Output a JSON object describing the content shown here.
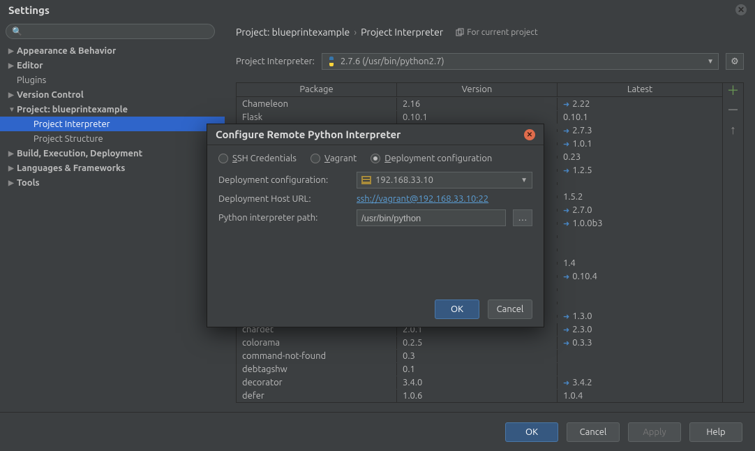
{
  "title": "Settings",
  "search_placeholder": "",
  "sidebar": {
    "items": [
      {
        "label": "Appearance & Behavior",
        "arrow": "▶",
        "bold": true
      },
      {
        "label": "Editor",
        "arrow": "▶",
        "bold": true
      },
      {
        "label": "Plugins",
        "arrow": "",
        "bold": false
      },
      {
        "label": "Version Control",
        "arrow": "▶",
        "bold": true
      },
      {
        "label": "Project: blueprintexample",
        "arrow": "▼",
        "bold": true
      },
      {
        "label": "Project Interpreter",
        "arrow": "",
        "bold": false,
        "indent": true,
        "selected": true
      },
      {
        "label": "Project Structure",
        "arrow": "",
        "bold": false,
        "indent": true
      },
      {
        "label": "Build, Execution, Deployment",
        "arrow": "▶",
        "bold": true
      },
      {
        "label": "Languages & Frameworks",
        "arrow": "▶",
        "bold": true
      },
      {
        "label": "Tools",
        "arrow": "▶",
        "bold": true
      }
    ]
  },
  "breadcrumb": {
    "project": "Project: blueprintexample",
    "page": "Project Interpreter",
    "for_project": "For current project"
  },
  "interpreter": {
    "label": "Project Interpreter:",
    "value": "2.7.6 (/usr/bin/python2.7)"
  },
  "table": {
    "headers": [
      "Package",
      "Version",
      "Latest"
    ],
    "rows": [
      {
        "pkg": "Chameleon",
        "ver": "2.16",
        "lat": "2.22",
        "up": true
      },
      {
        "pkg": "Flask",
        "ver": "0.10.1",
        "lat": "0.10.1",
        "up": false
      },
      {
        "pkg": "",
        "ver": "",
        "lat": "2.7.3",
        "up": true
      },
      {
        "pkg": "",
        "ver": "",
        "lat": "1.0.1",
        "up": true
      },
      {
        "pkg": "",
        "ver": "",
        "lat": "0.23",
        "up": false
      },
      {
        "pkg": "",
        "ver": "",
        "lat": "1.2.5",
        "up": true
      },
      {
        "pkg": "",
        "ver": "",
        "lat": "",
        "up": false
      },
      {
        "pkg": "",
        "ver": "",
        "lat": "1.5.2",
        "up": false
      },
      {
        "pkg": "",
        "ver": "",
        "lat": "2.7.0",
        "up": true
      },
      {
        "pkg": "",
        "ver": "",
        "lat": "1.0.0b3",
        "up": true
      },
      {
        "pkg": "",
        "ver": "",
        "lat": "",
        "up": false
      },
      {
        "pkg": "",
        "ver": "",
        "lat": "",
        "up": false
      },
      {
        "pkg": "",
        "ver": "",
        "lat": "1.4",
        "up": false
      },
      {
        "pkg": "",
        "ver": "",
        "lat": "0.10.4",
        "up": true
      },
      {
        "pkg": "",
        "ver": "",
        "lat": "",
        "up": false
      },
      {
        "pkg": "",
        "ver": "",
        "lat": "",
        "up": false
      },
      {
        "pkg": "",
        "ver": "",
        "lat": "1.3.0",
        "up": true
      },
      {
        "pkg": "chardet",
        "ver": "2.0.1",
        "lat": "2.3.0",
        "up": true
      },
      {
        "pkg": "colorama",
        "ver": "0.2.5",
        "lat": "0.3.3",
        "up": true
      },
      {
        "pkg": "command-not-found",
        "ver": "0.3",
        "lat": "",
        "up": false
      },
      {
        "pkg": "debtagshw",
        "ver": "0.1",
        "lat": "",
        "up": false
      },
      {
        "pkg": "decorator",
        "ver": "3.4.0",
        "lat": "3.4.2",
        "up": true
      },
      {
        "pkg": "defer",
        "ver": "1.0.6",
        "lat": "1.0.4",
        "up": false
      }
    ]
  },
  "footer": {
    "ok": "OK",
    "cancel": "Cancel",
    "apply": "Apply",
    "help": "Help"
  },
  "modal": {
    "title": "Configure Remote Python Interpreter",
    "radios": {
      "ssh": "SSH Credentials",
      "vagrant": "Vagrant",
      "deployment": "Deployment configuration"
    },
    "labels": {
      "deploy_config": "Deployment configuration:",
      "host_url": "Deployment Host URL:",
      "interp_path": "Python interpreter path:"
    },
    "values": {
      "deploy_config": "192.168.33.10",
      "host_url": "ssh://vagrant@192.168.33.10:22",
      "interp_path": "/usr/bin/python"
    },
    "buttons": {
      "ok": "OK",
      "cancel": "Cancel"
    }
  }
}
